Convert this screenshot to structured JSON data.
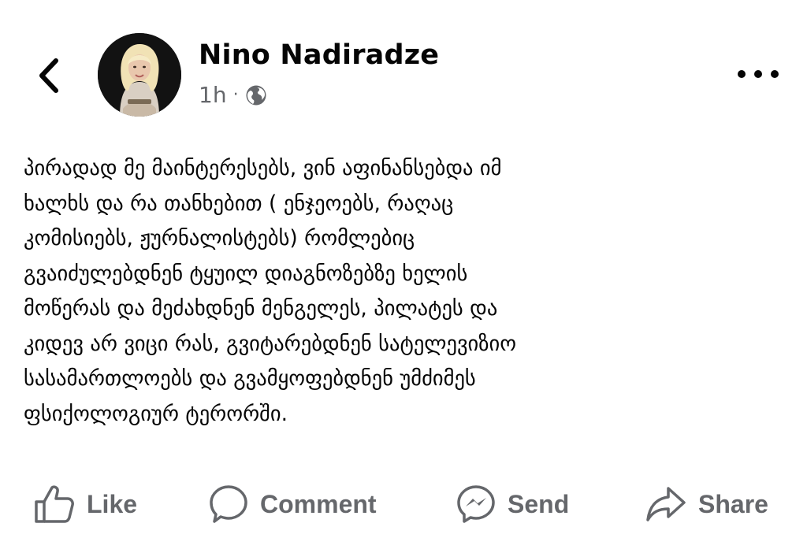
{
  "post": {
    "author": "Nino Nadiradze",
    "time": "1h",
    "separator": "·",
    "audience_icon": "globe-icon",
    "text_lines": [
      "პირადად მე მაინტერესებს, ვინ აფინანსებდა იმ",
      "ხალხს და რა თანხებით ( ენჯეოებს, რაღაც",
      "კომისიებს, ჟურნალისტებს) რომლებიც",
      "გვაიძულებდნენ ტყუილ დიაგნოზებზე ხელის",
      "მოწერას და მეძახდნენ მენგელეს, პილატეს და",
      "კიდევ არ ვიცი რას, გვიტარებდნენ სატელევიზიო",
      "სასამართლოებს და გვამყოფებდნენ უმძიმეს",
      "ფსიქოლოგიურ ტერორში."
    ]
  },
  "header": {
    "back_icon": "chevron-left-icon",
    "more_icon": "more-dots-icon"
  },
  "actions": {
    "like": "Like",
    "comment": "Comment",
    "send": "Send",
    "share": "Share"
  },
  "colors": {
    "text": "#050505",
    "secondary": "#65676b",
    "background": "#ffffff"
  }
}
